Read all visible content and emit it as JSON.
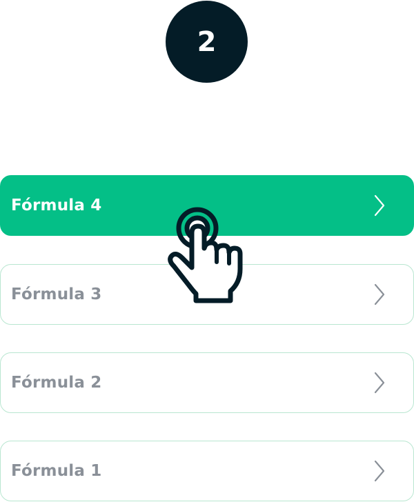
{
  "step": {
    "number": "2"
  },
  "formulas": [
    {
      "label": "Fórmula 4",
      "selected": true,
      "icon": "chevron-right-icon"
    },
    {
      "label": "Fórmula 3",
      "selected": false,
      "icon": "chevron-right-icon"
    },
    {
      "label": "Fórmula 2",
      "selected": false,
      "icon": "chevron-right-icon"
    },
    {
      "label": "Fórmula 1",
      "selected": false,
      "icon": "chevron-right-icon"
    }
  ],
  "colors": {
    "badge": "#041c27",
    "accent": "#04bf87",
    "item_border": "#b8e6d0",
    "inactive_text": "#8a9098"
  },
  "cursor_icon": "hand-pointer-icon"
}
